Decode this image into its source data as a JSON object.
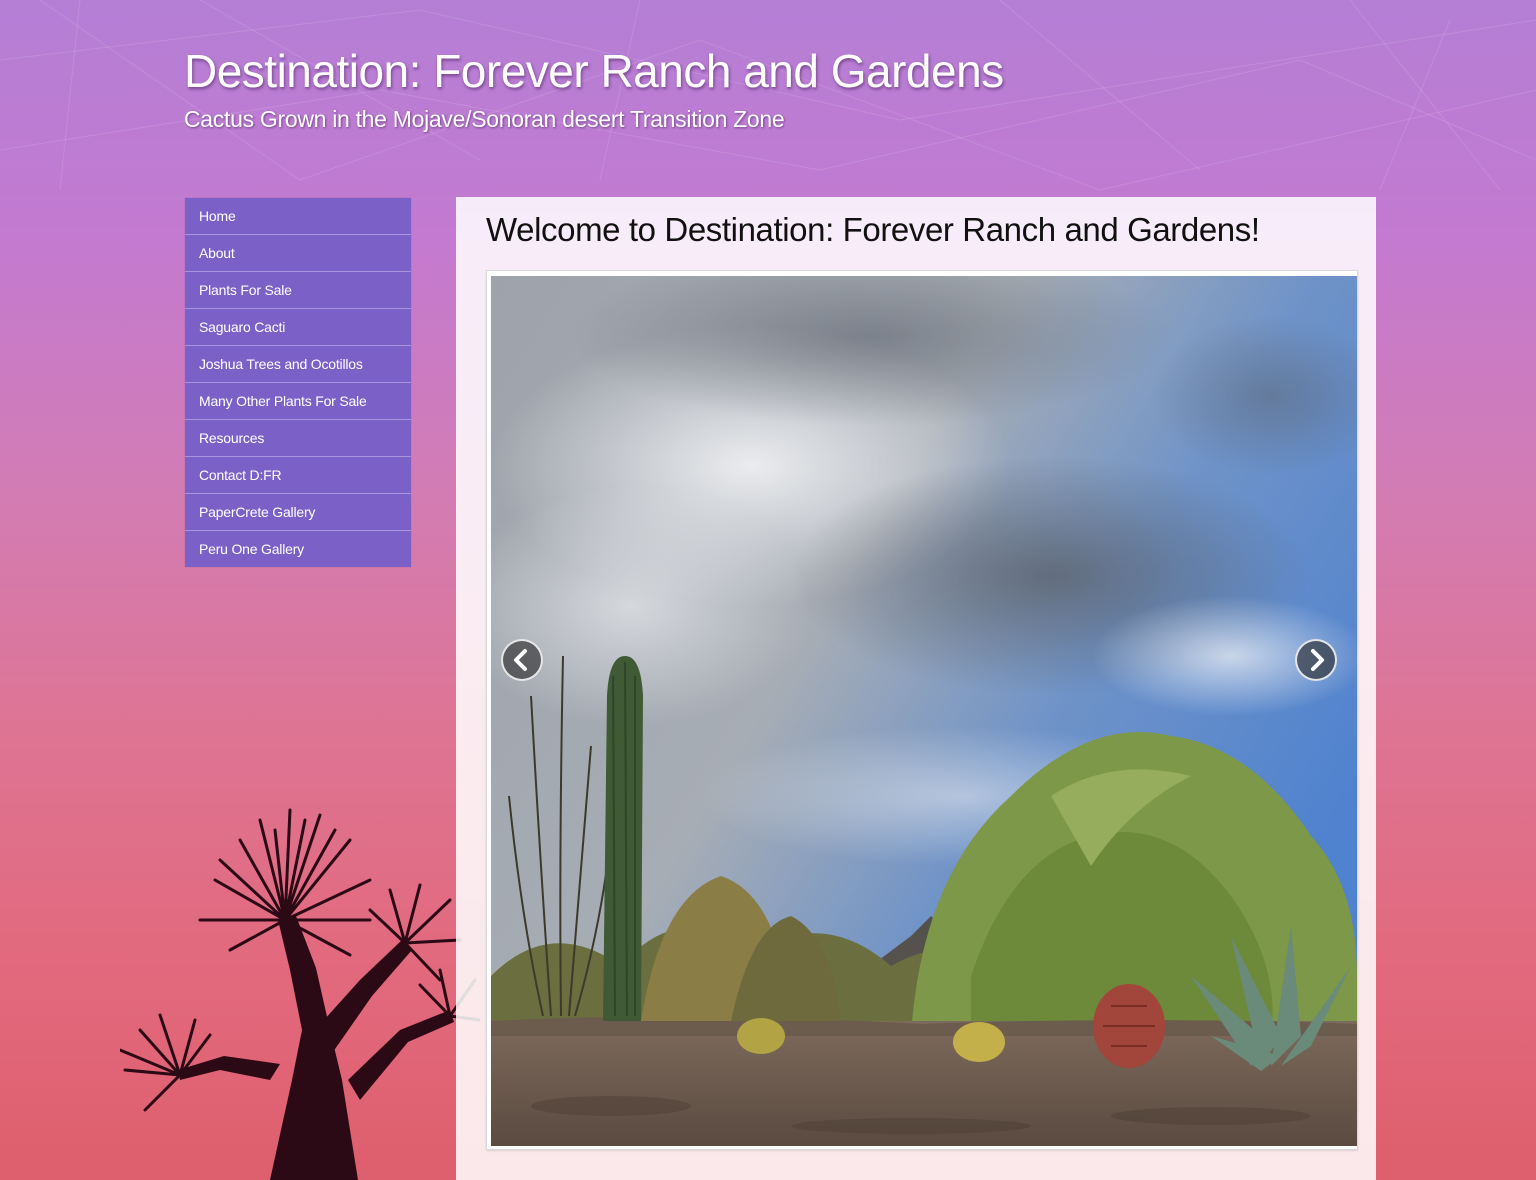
{
  "header": {
    "site_title": "Destination: Forever Ranch and Gardens",
    "tagline": "Cactus Grown in the Mojave/Sonoran desert Transition Zone"
  },
  "sidebar": {
    "items": [
      {
        "label": "Home"
      },
      {
        "label": "About"
      },
      {
        "label": "Plants For Sale"
      },
      {
        "label": "Saguaro Cacti"
      },
      {
        "label": "Joshua Trees and Ocotillos"
      },
      {
        "label": "Many Other Plants For Sale"
      },
      {
        "label": "Resources"
      },
      {
        "label": "Contact D:FR"
      },
      {
        "label": "PaperCrete Gallery"
      },
      {
        "label": "Peru One Gallery"
      }
    ]
  },
  "main": {
    "title": "Welcome to Destination: Forever Ranch and Gardens!",
    "slider": {
      "prev_icon": "chevron-left-icon",
      "next_icon": "chevron-right-icon"
    }
  },
  "colors": {
    "nav_background": "#7b60c8",
    "nav_divider": "#a795dd",
    "gradient_top": "#b57fd6",
    "gradient_bottom": "#de5f6d"
  }
}
